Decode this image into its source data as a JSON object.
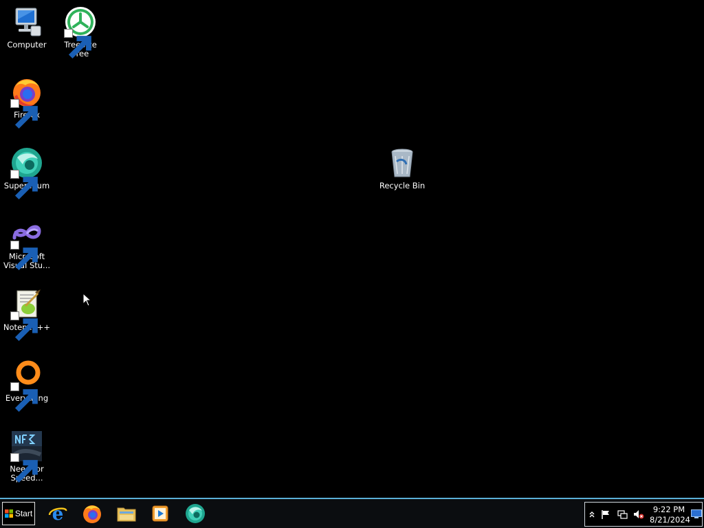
{
  "desktop": {
    "icons": [
      {
        "label": "Computer"
      },
      {
        "label": "TreeSize\nFree"
      },
      {
        "label": "Firefox"
      },
      {
        "label": "Supermium"
      },
      {
        "label": "Microsoft\nVisual Stu..."
      },
      {
        "label": "Notepad++"
      },
      {
        "label": "Everything"
      },
      {
        "label": "Need for\nSpeed..."
      },
      {
        "label": "Recycle Bin"
      }
    ]
  },
  "taskbar": {
    "start_label": "Start",
    "apps": [
      "internet-explorer-icon",
      "firefox-icon",
      "file-explorer-icon",
      "media-player-icon",
      "supermium-icon"
    ],
    "clock": {
      "time": "9:22 PM",
      "date": "8/21/2024"
    }
  },
  "colors": {
    "desktop_bg": "#000000",
    "taskbar_accent": "#5ab0d8"
  }
}
